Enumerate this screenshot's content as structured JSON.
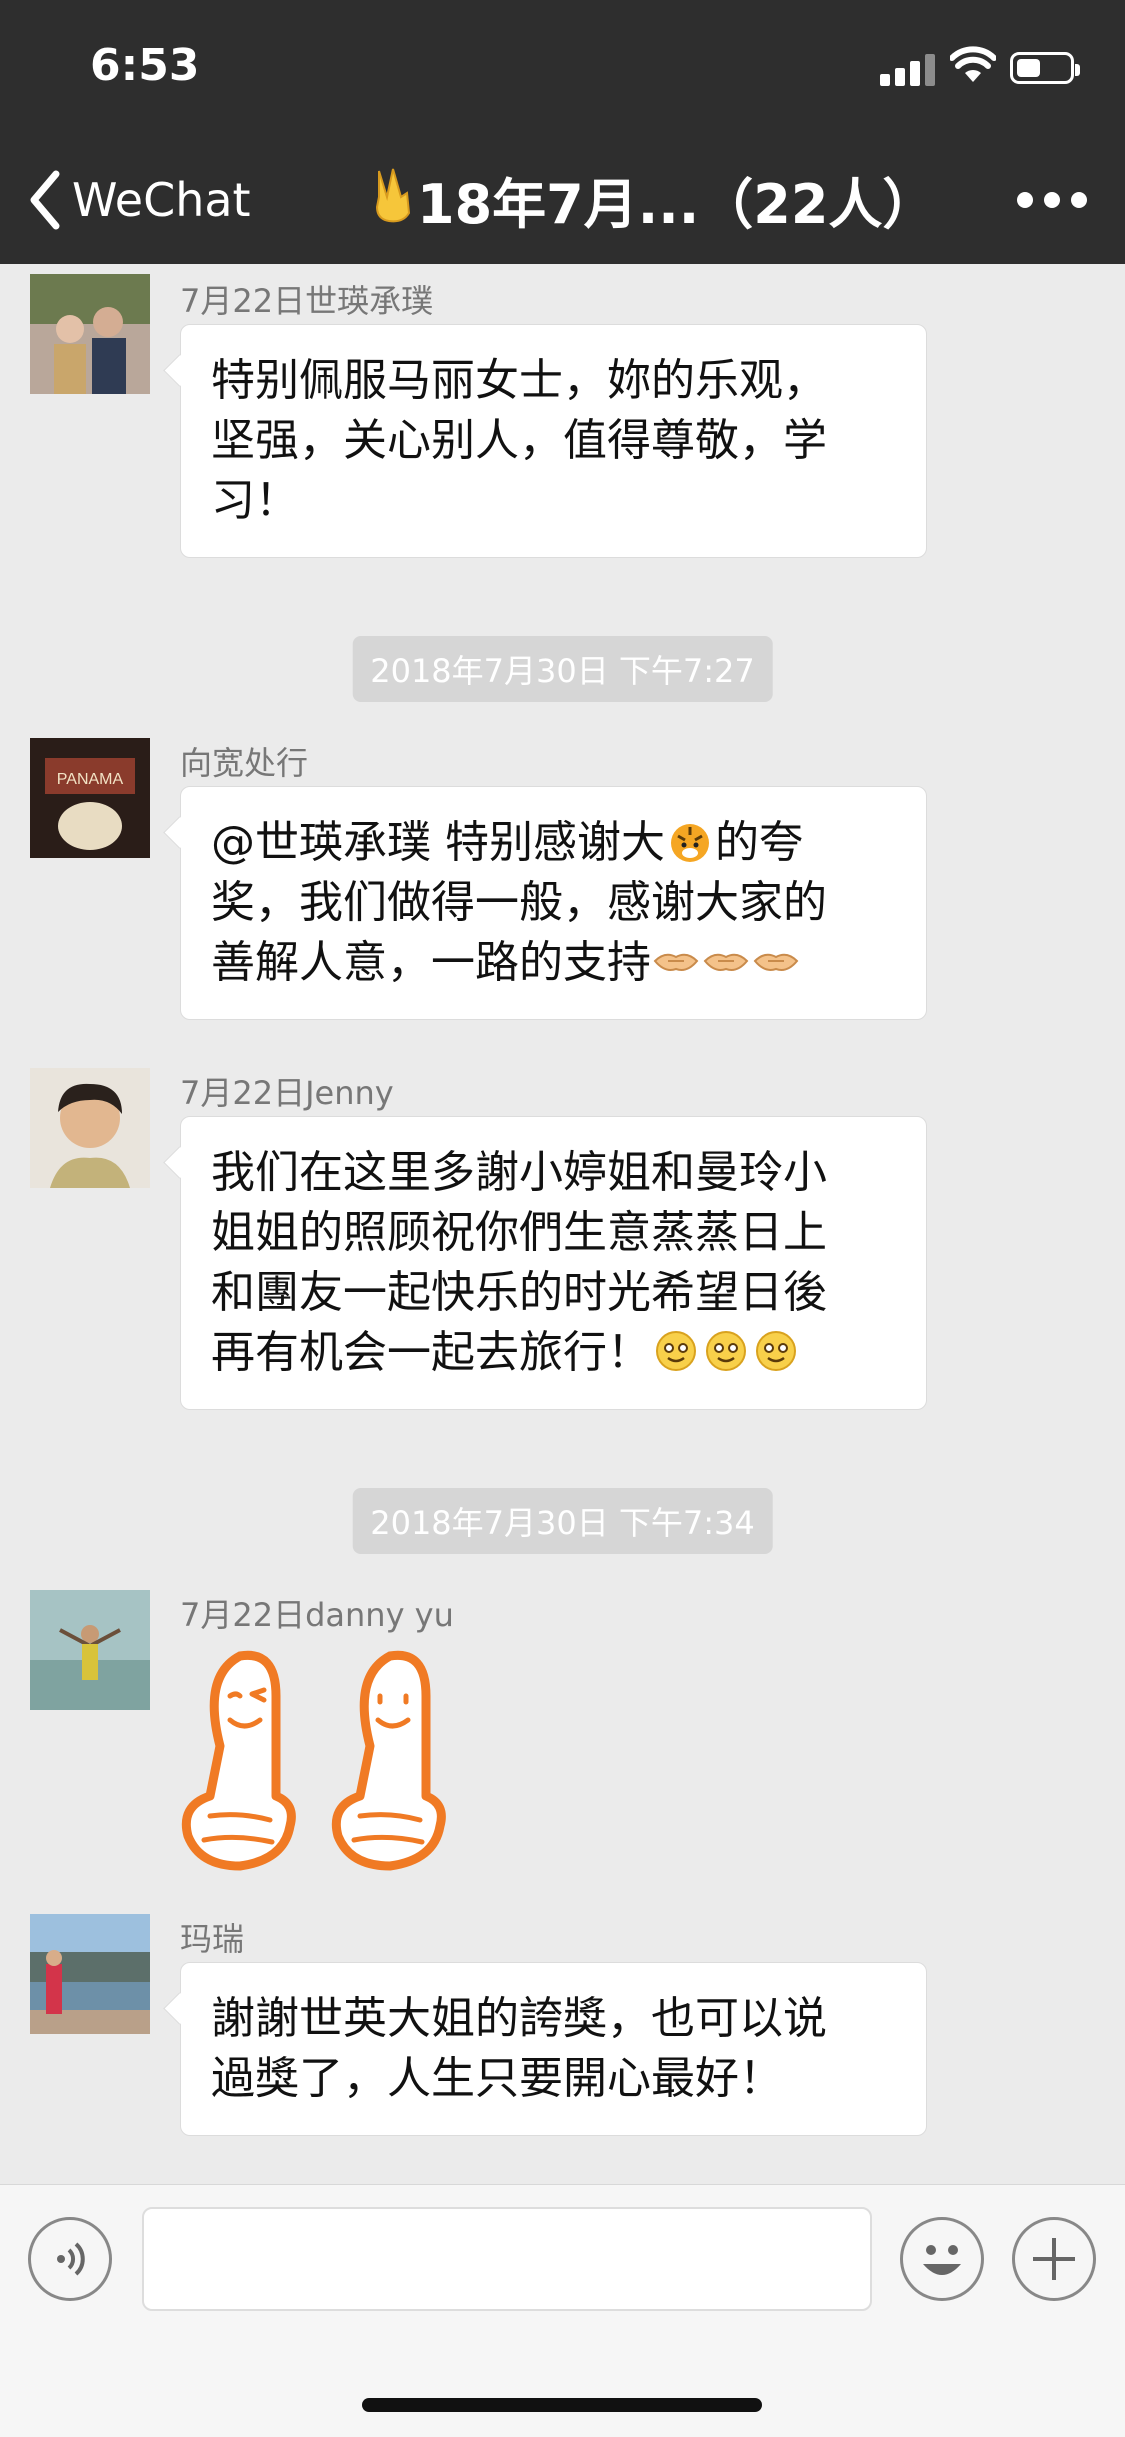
{
  "status": {
    "time": "6:53",
    "signal_icon": "signal-bars-icon",
    "wifi_icon": "wifi-icon",
    "battery_icon": "battery-icon",
    "battery_level": 0.45
  },
  "nav": {
    "back_label": "WeChat",
    "title": "18年7月...（22人）",
    "title_emoji": "victory-hand-emoji",
    "more_icon": "more-dots-icon"
  },
  "colors": {
    "bar": "#2e2e2e",
    "chat_bg": "#ebebeb",
    "bubble": "#ffffff",
    "time_chip": "#d6d6d6"
  },
  "messages": [
    {
      "sender": "7月22日世瑛承璞",
      "text": "特别佩服马丽女士，妳的乐观，\n坚强，关心别人，值得尊敬，学\n习！"
    },
    {
      "timestamp": "2018年7月30日 下午7:27"
    },
    {
      "sender": "向宽处行",
      "text": "@世瑛承璞 特别感谢大",
      "text2": "的夸\n奖，我们做得一般，感谢大家的\n善解人意，一路的支持",
      "emojis": [
        "tiger-emoji",
        "handshake-emoji"
      ]
    },
    {
      "sender": "7月22日Jenny",
      "text": "我们在这里多謝小婷姐和曼玲小\n姐姐的照顾祝你們生意蒸蒸日上\n和團友一起快乐的时光希望日後\n再有机会一起去旅行！",
      "emojis": [
        "smile-emoji"
      ]
    },
    {
      "timestamp": "2018年7月30日 下午7:34"
    },
    {
      "sender": "7月22日danny yu",
      "sticker": "thumbs-up-sticker"
    },
    {
      "sender": "玛瑞",
      "text": "謝謝世英大姐的誇獎，也可以说\n過獎了，人生只要開心最好！"
    }
  ],
  "input_bar": {
    "voice_icon": "voice-icon",
    "emoji_icon": "emoji-face-icon",
    "plus_icon": "plus-icon"
  }
}
